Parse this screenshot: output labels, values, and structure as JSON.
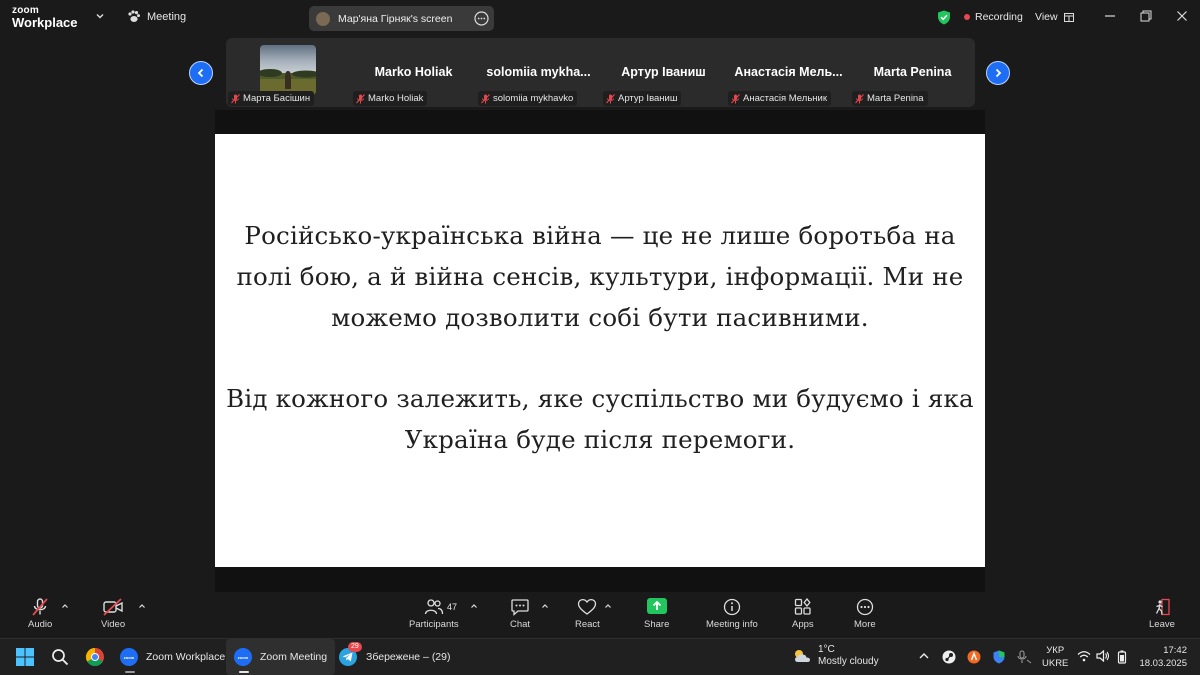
{
  "app": {
    "logo_line1": "zoom",
    "logo_line2": "Workplace",
    "meeting_label": "Meeting",
    "screen_owner": "Мар'яна Гірняк's screen",
    "recording_label": "Recording",
    "view_label": "View"
  },
  "participants": [
    {
      "tile_name": "",
      "tag": "Марта Басішин",
      "has_photo": true
    },
    {
      "tile_name": "Marko Holiak",
      "tag": "Marko Holiak"
    },
    {
      "tile_name": "solomiia  mykha...",
      "tag": "solomiia mykhavko"
    },
    {
      "tile_name": "Артур Іваниш",
      "tag": "Артур Іваниш"
    },
    {
      "tile_name": "Анастасія  Мель...",
      "tag": "Анастасія Мельник"
    },
    {
      "tile_name": "Marta Penina",
      "tag": "Marta Penina"
    }
  ],
  "slide": {
    "paragraph1": "Російсько-українська війна — це не лише боротьба на полі бою, а й війна сенсів, культури, інформації. Ми не можемо дозволити собі бути пасивними.",
    "paragraph2": "Від кожного залежить, яке суспільство ми будуємо і яка Україна буде після перемоги."
  },
  "toolbar": {
    "audio": "Audio",
    "video": "Video",
    "participants": "Participants",
    "participants_count": "47",
    "chat": "Chat",
    "react": "React",
    "share": "Share",
    "meeting_info": "Meeting info",
    "apps": "Apps",
    "more": "More",
    "leave": "Leave"
  },
  "taskbar": {
    "zoom_workplace": "Zoom Workplace",
    "zoom_meeting": "Zoom Meeting",
    "telegram": "Збережене – (29)",
    "telegram_badge": "29",
    "zoom_icon_text": "zoom",
    "weather_temp": "1°C",
    "weather_desc": "Mostly cloudy",
    "lang1": "УКР",
    "lang2": "UKRE",
    "time": "17:42",
    "date": "18.03.2025"
  },
  "colors": {
    "accent": "#1e6ef5",
    "share_green": "#22c55e",
    "record_red": "#e5484d",
    "muted_red": "#e5484d"
  }
}
